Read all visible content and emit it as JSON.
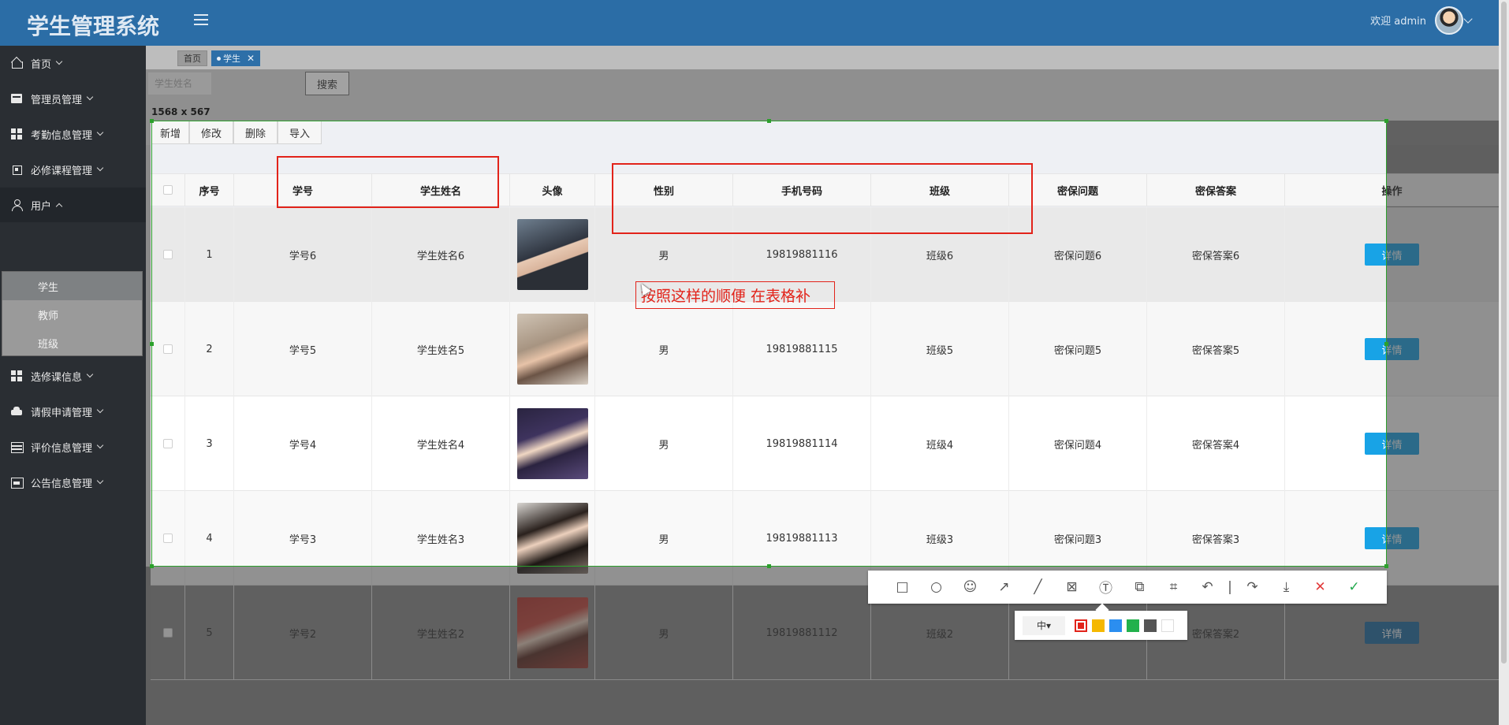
{
  "app": {
    "title": "学生管理系统",
    "welcome": "欢迎 admin"
  },
  "sidebar": {
    "items": [
      {
        "label": "首页",
        "icon": "home-icon"
      },
      {
        "label": "管理员管理",
        "icon": "card-icon"
      },
      {
        "label": "考勤信息管理",
        "icon": "grid-icon"
      },
      {
        "label": "必修课程管理",
        "icon": "chip-icon"
      },
      {
        "label": "用户",
        "icon": "user-icon"
      },
      {
        "label": "选修课信息",
        "icon": "grid-icon"
      },
      {
        "label": "请假申请管理",
        "icon": "car-icon"
      },
      {
        "label": "评价信息管理",
        "icon": "table-icon"
      },
      {
        "label": "公告信息管理",
        "icon": "image-icon"
      }
    ],
    "submenu": [
      "学生",
      "教师",
      "班级"
    ]
  },
  "tabs": [
    {
      "label": "首页"
    },
    {
      "label": "学生",
      "close": "✕"
    }
  ],
  "search": {
    "placeholder": "学生姓名",
    "button": "搜索"
  },
  "selection": {
    "dimension_label": "1568 x 567"
  },
  "toolbar": {
    "add": "新增",
    "edit": "修改",
    "delete": "删除",
    "import": "导入"
  },
  "table": {
    "headers": [
      "序号",
      "学号",
      "学生姓名",
      "头像",
      "性别",
      "手机号码",
      "班级",
      "密保问题",
      "密保答案",
      "操作"
    ],
    "rows": [
      {
        "index": "1",
        "student_no": "学号6",
        "name": "学生姓名6",
        "gender": "男",
        "phone": "19819881116",
        "class": "班级6",
        "question": "密保问题6",
        "answer": "密保答案6",
        "action": "详情"
      },
      {
        "index": "2",
        "student_no": "学号5",
        "name": "学生姓名5",
        "gender": "男",
        "phone": "19819881115",
        "class": "班级5",
        "question": "密保问题5",
        "answer": "密保答案5",
        "action": "详情"
      },
      {
        "index": "3",
        "student_no": "学号4",
        "name": "学生姓名4",
        "gender": "男",
        "phone": "19819881114",
        "class": "班级4",
        "question": "密保问题4",
        "answer": "密保答案4",
        "action": "详情"
      },
      {
        "index": "4",
        "student_no": "学号3",
        "name": "学生姓名3",
        "gender": "男",
        "phone": "19819881113",
        "class": "班级3",
        "question": "密保问题3",
        "answer": "密保答案3",
        "action": "详情"
      },
      {
        "index": "5",
        "student_no": "学号2",
        "name": "学生姓名2",
        "gender": "男",
        "phone": "19819881112",
        "class": "班级2",
        "question": "密保问题2",
        "answer": "密保答案2",
        "action": "详情"
      }
    ]
  },
  "annotation": {
    "text": "按照这样的顺便  在表格补"
  },
  "shot_tool": {
    "tools": [
      "rect-tool-icon",
      "ellipse-tool-icon",
      "emoji-tool-icon",
      "arrow-tool-icon",
      "line-tool-icon",
      "mosaic-tool-icon",
      "text-tool-icon",
      "pin-tool-icon",
      "ocr-tool-icon",
      "undo-icon",
      "share-icon",
      "save-icon",
      "close-icon",
      "confirm-icon"
    ],
    "size_label": "中",
    "colors": [
      "#e2231a",
      "#f5b800",
      "#2b8ef0",
      "#22b14c",
      "#555555",
      "#ffffff"
    ]
  },
  "colors": {
    "topbar": "#2b6da6",
    "sidebar": "#2a2e33",
    "accent": "#18a3e6",
    "selection": "#2ca02c",
    "annotation": "#e2231a"
  }
}
